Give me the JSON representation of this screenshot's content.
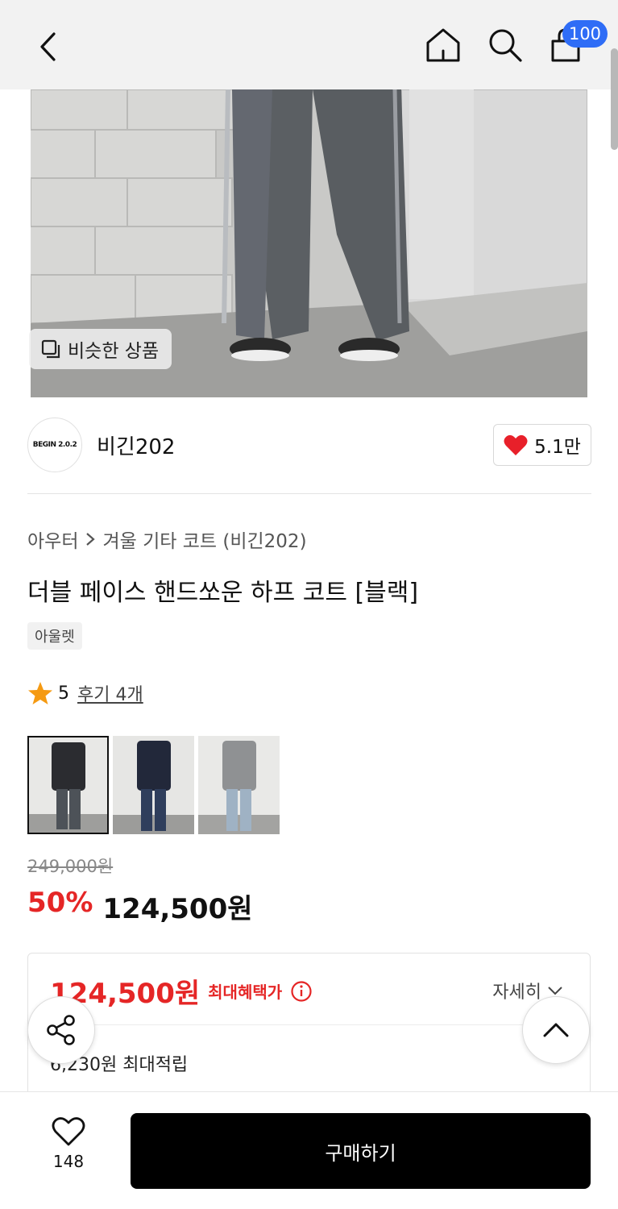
{
  "header": {
    "icons": [
      "chevron-left-icon",
      "home-icon",
      "search-icon",
      "bag-icon"
    ],
    "cart_badge": "100"
  },
  "hero": {
    "similar_label": "비슷한 상품"
  },
  "brand": {
    "logo_text": "BEGIN 2.0.2",
    "name": "비긴202",
    "like_count": "5.1만"
  },
  "product": {
    "breadcrumb": [
      "아우터",
      "겨울 기타 코트 (비긴202)"
    ],
    "title": "더블 페이스 핸드쏘운 하프 코트 [블랙]",
    "tag": "아울렛",
    "rating": "5",
    "review_link": "후기 4개",
    "original_price": "249,000원",
    "discount_pct": "50%",
    "sale_price": "124,500원"
  },
  "benefit": {
    "max_price": "124,500원",
    "max_label": "최대혜택가",
    "detail_label": "자세히",
    "points_text": "6,230원 최대적립"
  },
  "bottom": {
    "wish_count": "148",
    "buy_label": "구매하기"
  },
  "colors": {
    "accent_red": "#e52626",
    "badge_blue": "#2f6df6",
    "buy_black": "#000000",
    "heart_red": "#e8202a",
    "star_orange": "#f59a12"
  }
}
